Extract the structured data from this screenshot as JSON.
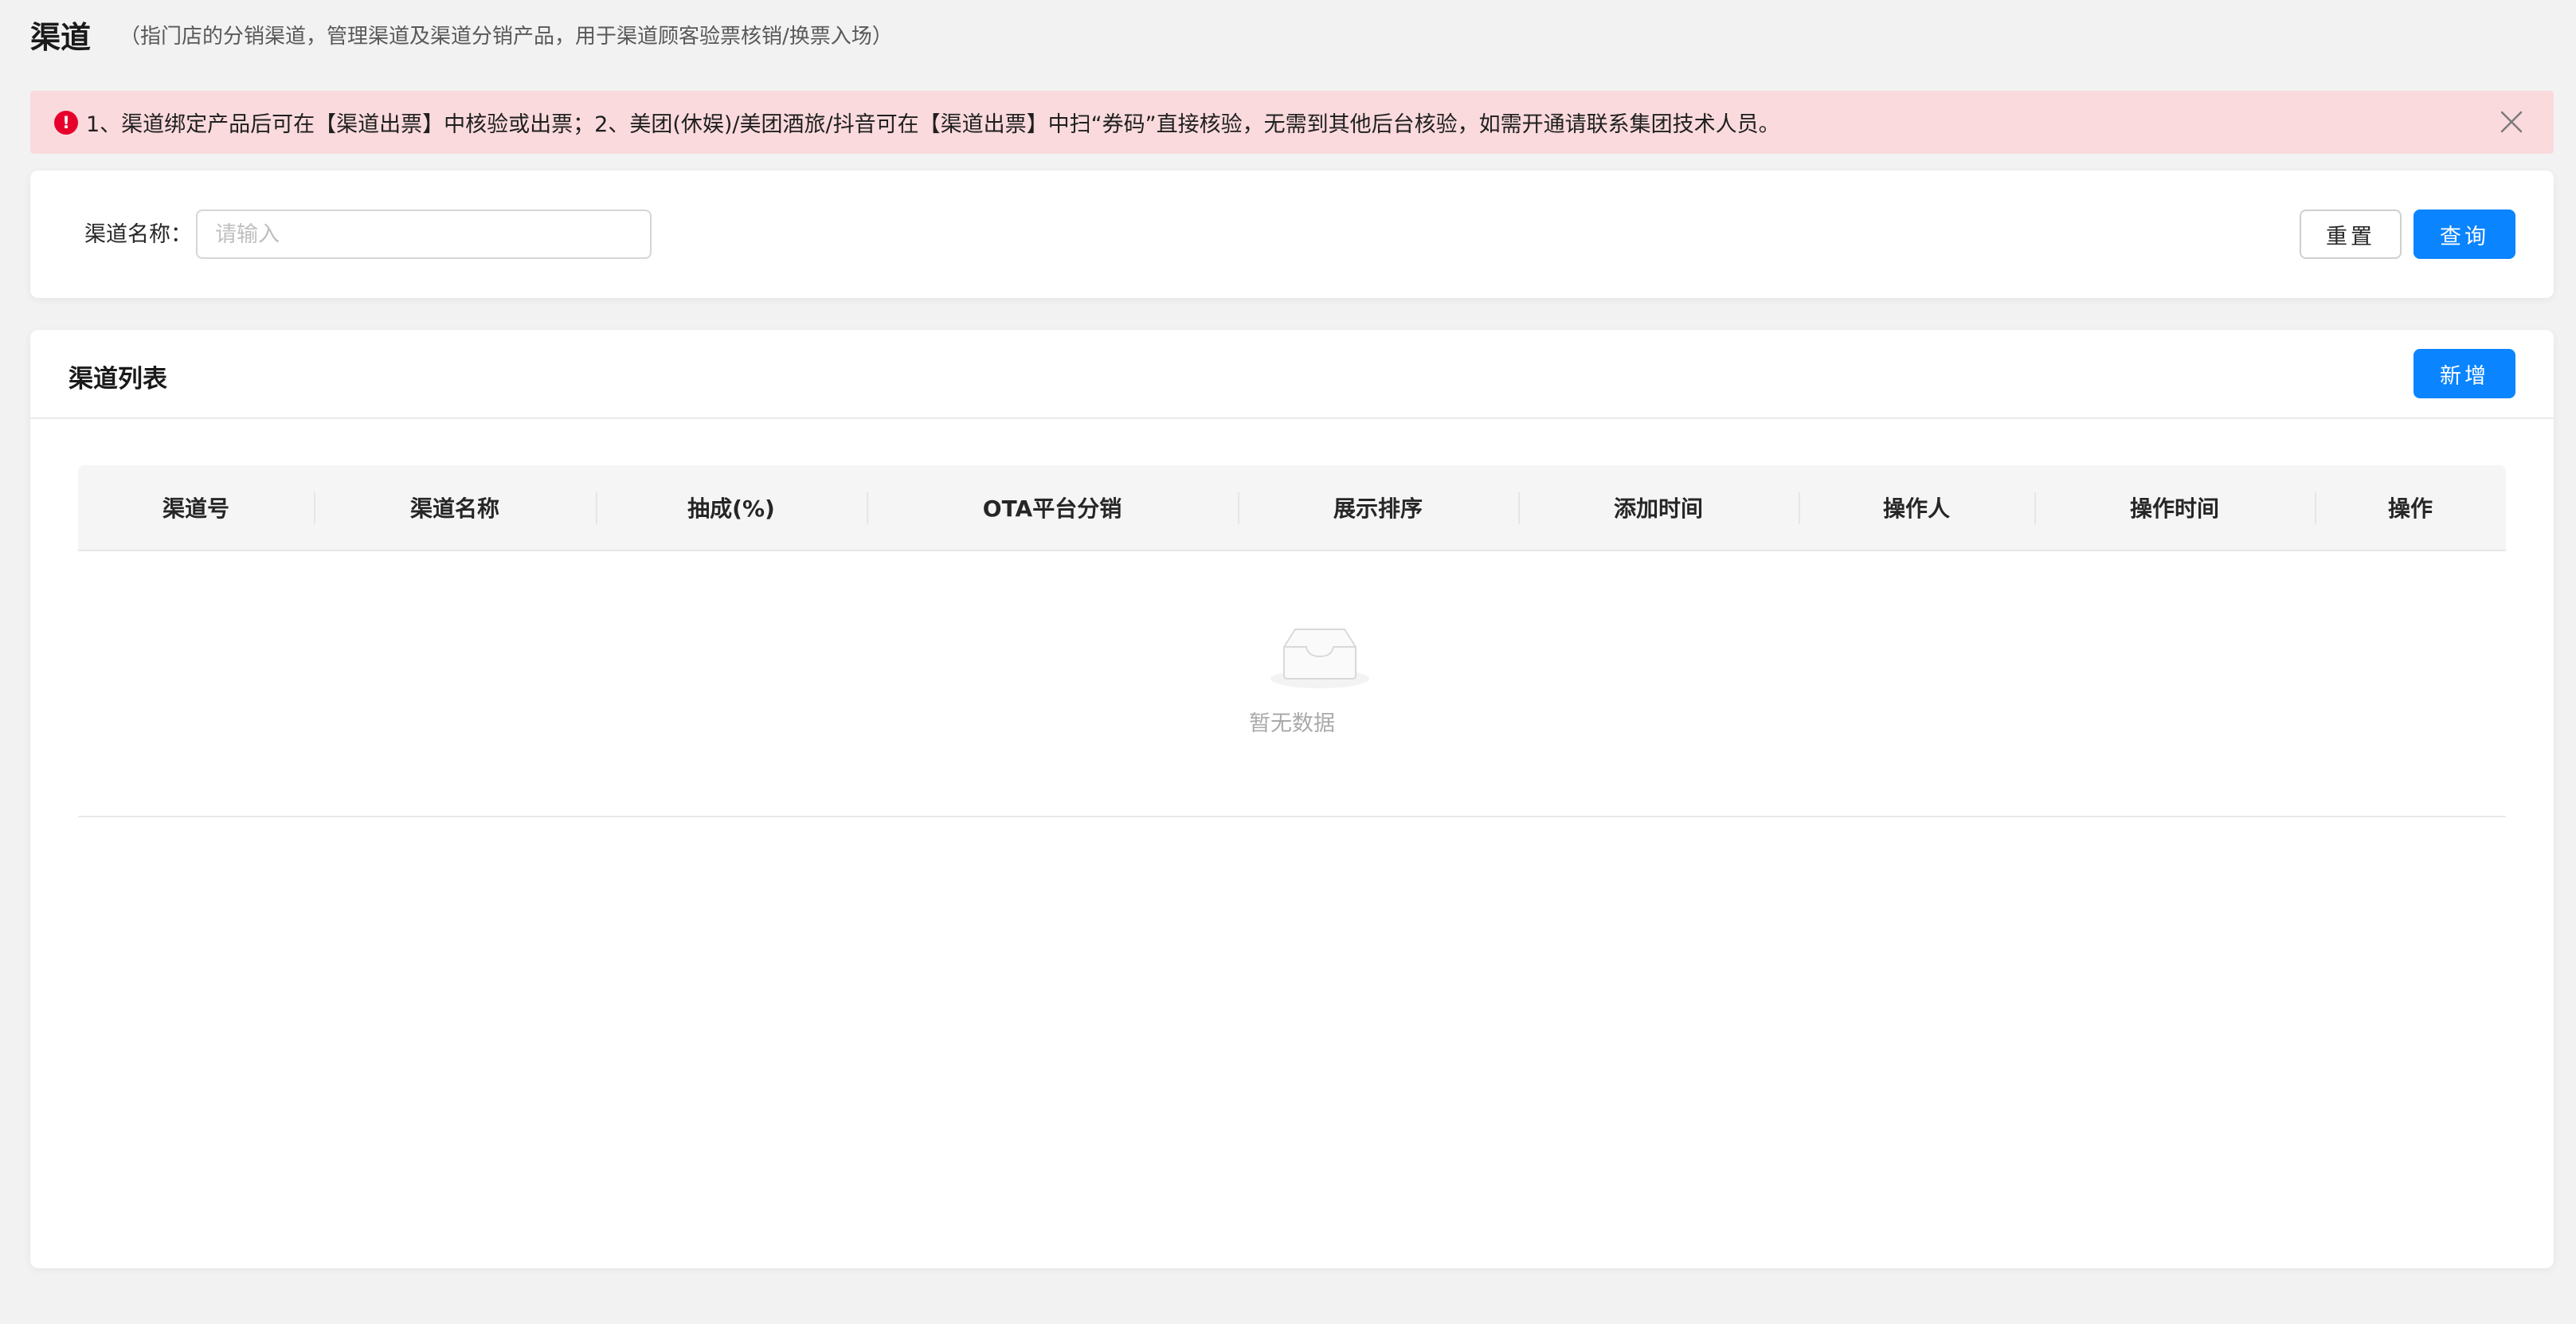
{
  "header": {
    "title": "渠道",
    "subtitle": "（指门店的分销渠道，管理渠道及渠道分销产品，用于渠道顾客验票核销/换票入场）"
  },
  "alert": {
    "text": "1、渠道绑定产品后可在【渠道出票】中核验或出票；2、美团(休娱)/美团酒旅/抖音可在【渠道出票】中扫“券码”直接核验，无需到其他后台核验，如需开通请联系集团技术人员。",
    "icon": "!",
    "color": "#fadadd"
  },
  "search": {
    "label": "渠道名称：",
    "placeholder": "请输入",
    "value": "",
    "reset_label": "重置",
    "query_label": "查询"
  },
  "list": {
    "title": "渠道列表",
    "add_label": "新增",
    "columns": [
      "渠道号",
      "渠道名称",
      "抽成(%)",
      "OTA平台分销",
      "展示排序",
      "添加时间",
      "操作人",
      "操作时间",
      "操作"
    ],
    "rows": [],
    "empty_text": "暂无数据"
  },
  "colors": {
    "primary": "#0a84ff",
    "alert_icon": "#e8002c"
  }
}
